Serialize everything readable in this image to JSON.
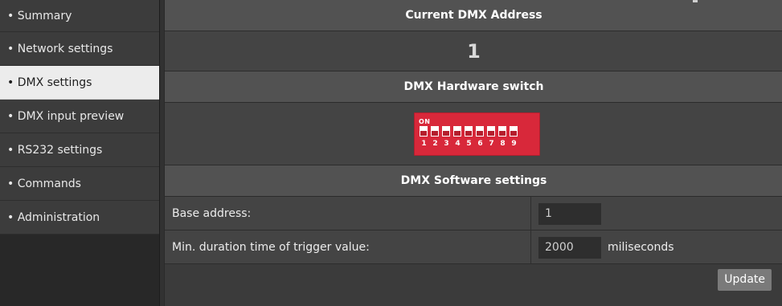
{
  "sidebar": {
    "items": [
      {
        "label": "• Summary"
      },
      {
        "label": "• Network settings"
      },
      {
        "label": "• DMX settings"
      },
      {
        "label": "• DMX input preview"
      },
      {
        "label": "• RS232 settings"
      },
      {
        "label": "• Commands"
      },
      {
        "label": "• Administration"
      }
    ],
    "active_index": 2
  },
  "main": {
    "current_address_title": "Current DMX Address",
    "current_address_value": "1",
    "hardware_switch_title": "DMX Hardware switch",
    "dip_switch": {
      "on_label": "ON",
      "numbers": [
        "1",
        "2",
        "3",
        "4",
        "5",
        "6",
        "7",
        "8",
        "9"
      ],
      "color": "#d8283a"
    },
    "software_settings_title": "DMX Software settings",
    "base_address": {
      "label": "Base address:",
      "value": "1"
    },
    "min_duration": {
      "label": "Min. duration time of trigger value:",
      "value": "2000",
      "unit": "miliseconds"
    },
    "update_label": "Update"
  }
}
